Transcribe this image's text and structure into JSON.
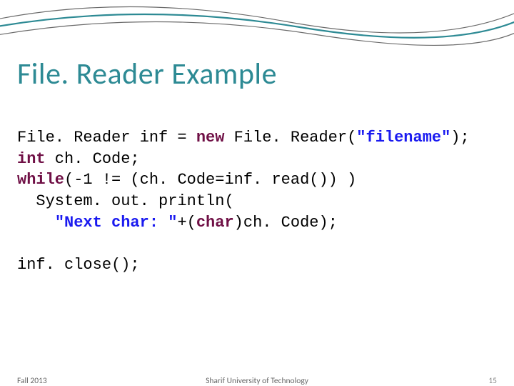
{
  "title": "File. Reader Example",
  "code": {
    "line1_a": "File. Reader inf = ",
    "line1_kw": "new",
    "line1_b": " File. Reader(",
    "line1_str": "\"filename\"",
    "line1_c": ");",
    "line2_kw": "int",
    "line2_a": " ch. Code;",
    "line3_kw": "while",
    "line3_a": "(-1 != (ch. Code=inf. read()) )",
    "line4": "  System. out. println(",
    "line5_a": "    ",
    "line5_str": "\"Next char: \"",
    "line5_b": "+(",
    "line5_kw": "char",
    "line5_c": ")ch. Code);",
    "blank": "",
    "line6": "inf. close();"
  },
  "footer": {
    "left": "Fall 2013",
    "center": "Sharif University of Technology",
    "right": "15"
  }
}
